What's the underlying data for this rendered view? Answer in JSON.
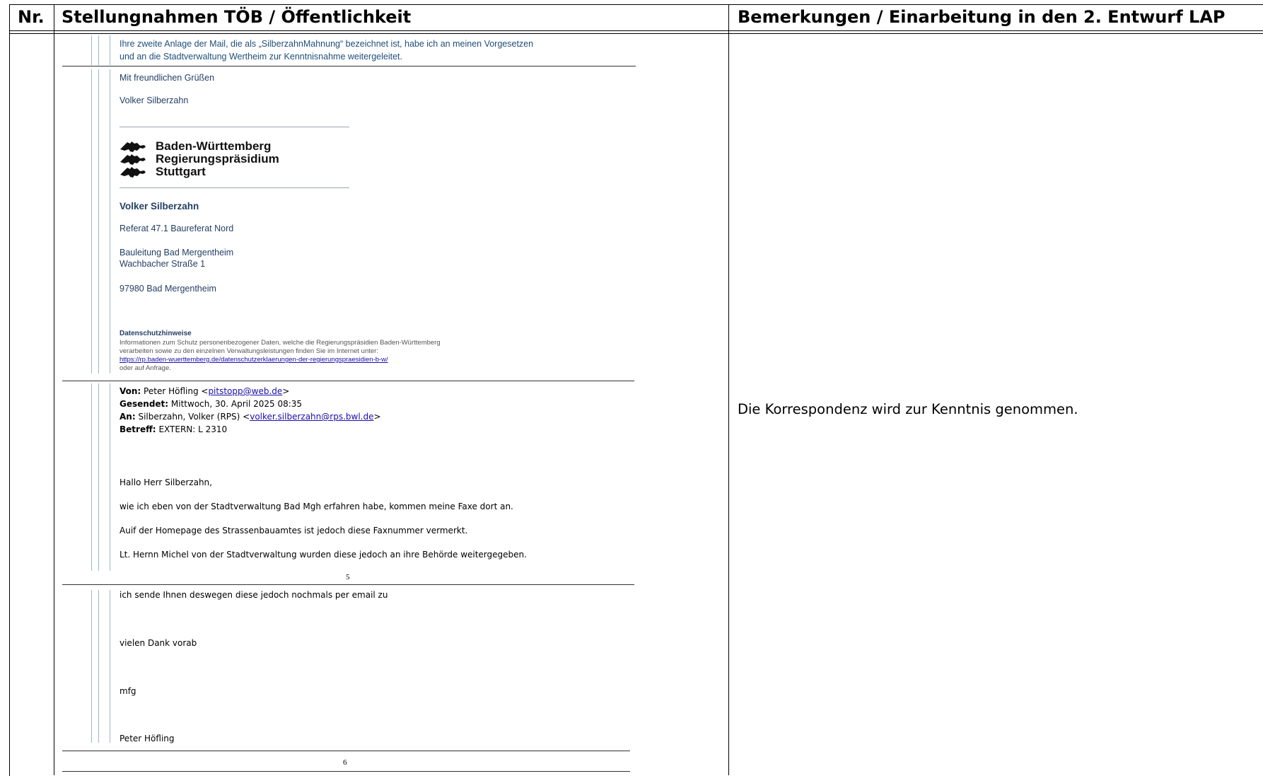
{
  "header": {
    "nr": "Nr.",
    "statements": "Stellungnahmen TÖB / Öffentlichkeit",
    "remarks": "Bemerkungen / Einarbeitung in den 2. Entwurf LAP"
  },
  "letter": {
    "intro_line1": "Ihre zweite Anlage der Mail, die als „SilberzahnMahnung“ bezeichnet ist, habe ich an meinen Vorgesetzen",
    "intro_line2": "und an die Stadtverwaltung Wertheim zur Kenntnisnahme weitergeleitet.",
    "greeting": "Mit freundlichen Grüßen",
    "sender_name": "Volker Silberzahn",
    "logo": {
      "line1": "Baden-Württemberg",
      "line2": "Regierungspräsidium",
      "line3": "Stuttgart"
    },
    "sig_name": "Volker Silberzahn",
    "department": "Referat 47.1 Baureferat Nord",
    "office": "Bauleitung Bad Mergentheim",
    "street": "Wachbacher Straße 1",
    "city": "97980 Bad Mergentheim",
    "privacy_title": "Datenschutzhinweise",
    "privacy_line1": "Informationen zum Schutz personenbezogener Daten, welche die Regierungspräsidien Baden-Württemberg",
    "privacy_line2": "verarbeiten sowie zu den einzelnen Verwaltungsleistungen finden Sie im Internet unter:",
    "privacy_link": "https://rp.baden-wuerttemberg.de/datenschutzerklaerungen-der-regierungspraesidien-b-w/",
    "privacy_line3": "oder auf Anfrage.",
    "from_label": "Von:",
    "from_value": "Peter Höfling <",
    "from_email": "pitstopp@web.de",
    "from_close": ">",
    "sent_label": "Gesendet:",
    "sent_value": "Mittwoch, 30. April 2025 08:35",
    "to_label": "An:",
    "to_value": "Silberzahn, Volker (RPS) <",
    "to_email": "volker.silberzahn@rps.bwl.de",
    "to_close": ">",
    "subject_label": "Betreff:",
    "subject_value": "EXTERN: L 2310",
    "salutation": "Hallo Herr Silberzahn,",
    "body1": "wie ich eben von der Stadtverwaltung Bad Mgh erfahren habe, kommen meine Faxe dort an.",
    "body2": "Auif der Homepage des Strassenbauamtes ist jedoch diese Faxnummer vermerkt.",
    "body3": "Lt. Hernn Michel von der Stadtverwaltung wurden diese jedoch an ihre Behörde weitergegeben.",
    "page5": "5",
    "body4": "ich sende Ihnen deswegen diese jedoch nochmals per email zu",
    "thanks": "vielen Dank vorab",
    "closing": "mfg",
    "signoff": "Peter Höfling",
    "page6": "6"
  },
  "remark": "Die Korrespondenz wird zur Kenntnis genommen."
}
